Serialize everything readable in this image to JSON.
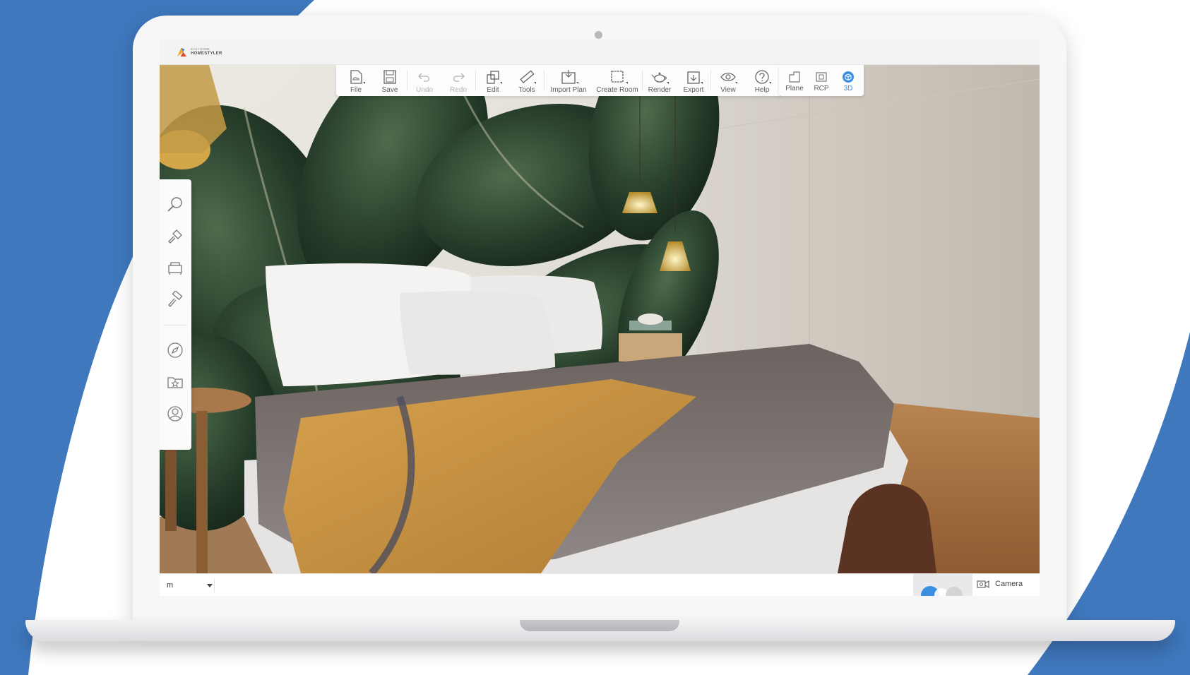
{
  "app": {
    "brand_small": "EASYHOME",
    "brand_name": "HOMESTYLER"
  },
  "toolbar": {
    "items": [
      {
        "label": "File",
        "icon": "file-icon",
        "enabled": true,
        "has_menu": true
      },
      {
        "label": "Save",
        "icon": "save-icon",
        "enabled": true,
        "has_menu": false
      },
      {
        "label": "Undo",
        "icon": "undo-icon",
        "enabled": false,
        "has_menu": false
      },
      {
        "label": "Redo",
        "icon": "redo-icon",
        "enabled": false,
        "has_menu": false
      },
      {
        "label": "Edit",
        "icon": "edit-icon",
        "enabled": true,
        "has_menu": true
      },
      {
        "label": "Tools",
        "icon": "ruler-icon",
        "enabled": true,
        "has_menu": true
      },
      {
        "label": "Import Plan",
        "icon": "import-plan-icon",
        "enabled": true,
        "has_menu": true
      },
      {
        "label": "Create Room",
        "icon": "create-room-icon",
        "enabled": true,
        "has_menu": true
      },
      {
        "label": "Render",
        "icon": "teapot-icon",
        "enabled": true,
        "has_menu": true
      },
      {
        "label": "Export",
        "icon": "export-icon",
        "enabled": true,
        "has_menu": true
      },
      {
        "label": "View",
        "icon": "eye-icon",
        "enabled": true,
        "has_menu": true
      },
      {
        "label": "Help",
        "icon": "help-icon",
        "enabled": true,
        "has_menu": true
      }
    ]
  },
  "view_modes": {
    "items": [
      {
        "label": "Plane",
        "icon": "plane-view-icon",
        "active": false
      },
      {
        "label": "RCP",
        "icon": "rcp-view-icon",
        "active": false
      },
      {
        "label": "3D",
        "icon": "3d-cube-icon",
        "active": true
      }
    ],
    "active_color": "#3b8fe0"
  },
  "sidebar": {
    "items": [
      {
        "icon": "search-icon"
      },
      {
        "icon": "build-tools-icon"
      },
      {
        "icon": "furniture-icon"
      },
      {
        "icon": "paint-roller-icon"
      },
      {
        "icon": "compass-icon"
      },
      {
        "icon": "favorites-folder-icon"
      },
      {
        "icon": "user-profile-icon"
      }
    ]
  },
  "bottom_bar": {
    "unit_value": "m",
    "camera_label": "Camera",
    "camera_icon": "camera-icon"
  },
  "colors": {
    "brand_blue": "#3f78bd",
    "accent_blue": "#3b8fe0"
  }
}
